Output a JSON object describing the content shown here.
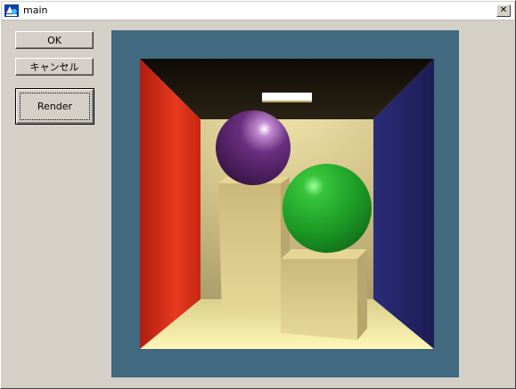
{
  "window": {
    "title": "main",
    "close_glyph": "✕"
  },
  "buttons": {
    "ok_label": "OK",
    "cancel_label": "キャンセル",
    "render_label": "Render"
  },
  "scene": {
    "background_color": "#41697f",
    "left_wall_color": "#d42a1a",
    "right_wall_color": "#2c2a7c",
    "back_wall_color": "#c8b877",
    "floor_color": "#f1e7a3",
    "ceiling_color": "#161009",
    "purple_sphere_color": "#5f2a73",
    "green_sphere_color": "#1f9e2a",
    "box_color": "#d8c685"
  }
}
